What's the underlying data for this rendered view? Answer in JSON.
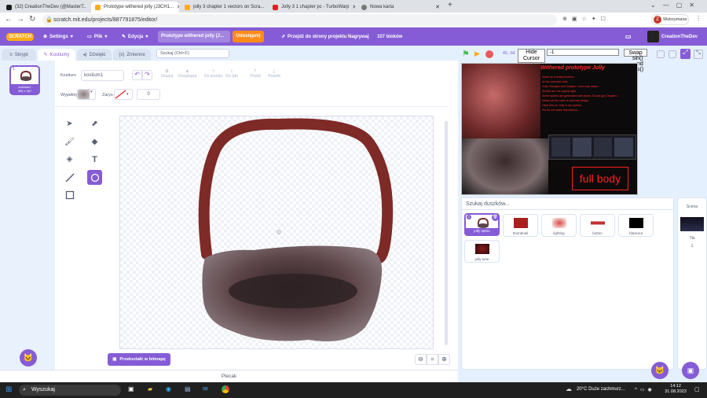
{
  "browser": {
    "tabs": [
      {
        "title": "(32) CreationTheDev (@MasterT..",
        "color": "#1d1d1d",
        "active": false
      },
      {
        "title": "Prototype withered jolly (J3CH1...",
        "color": "#ffab19",
        "active": true
      },
      {
        "title": "jolly 3 chapter 1 vectors on Scra...",
        "color": "#ffab19",
        "active": false
      },
      {
        "title": "Jolly 3 1 chapter pc - TurboWarp",
        "color": "#e02020",
        "active": false
      },
      {
        "title": "Nowa karta",
        "color": "#777",
        "active": false
      }
    ],
    "new_tab_label": "+",
    "url": "scratch.mit.edu/projects/887791875/editor/",
    "profile_label": "Wstrzymano",
    "profile_initial": "Z"
  },
  "menu": {
    "logo": "SCRATCH",
    "settings": "Settings",
    "file": "Plik",
    "edit": "Edycja",
    "project_title": "Prototype withered jolly (J...",
    "share": "Udostępnij",
    "go_to_project": "Przejdź do strony projektu",
    "record": "Nagrywaj",
    "blocks_count": "107 bloków",
    "username": "CreationTheDev"
  },
  "editor_tabs": {
    "code": "Skrypt",
    "costumes": "Kostiumy",
    "sounds": "Dźwięki",
    "variables": "Zmienne"
  },
  "search_placeholder": "Szukaj (Ctrl+F)",
  "costume": {
    "number": "1",
    "name": "kostium1",
    "size": "306 x 267"
  },
  "paint": {
    "costume_label": "Kostium",
    "costume_name": "kostium1",
    "group": "Grupuj",
    "ungroup": "Rozgrupuj",
    "forward": "Do przodu",
    "backward": "Do tyłu",
    "front": "Przód",
    "back": "Powrót",
    "fill_label": "Wypełnij",
    "outline_label": "Zarys",
    "outline_width": "0",
    "convert_bitmap": "Przekształć w bitmapę"
  },
  "stage": {
    "hide_cursor": "Hide Cursor",
    "value_field": "-1",
    "swap_label": "Swap",
    "swap_overflow": [
      "sin()",
      "nd",
      "s()"
    ],
    "title_text": "Withered prototype Jolly",
    "info_lines": [
      "Made by CreationTheDev",
      "Art by reversed Jolly",
      "Jolly Changes and Chapter 1 lore was drawn",
      "Sprites are not copied right",
      "Some sprites are generated with (from) J3 and got Chapter 1",
      "Added all the ones to add tmy design",
      "Have this on Jolly in my opinion",
      "Pls do not make this without ..."
    ],
    "full_body": "full body",
    "sprite_search": "Szukaj duszków...",
    "sprites": [
      {
        "name": "jolly optoo",
        "thumb": "#7a2a2a",
        "selected": true
      },
      {
        "name": "thumbnail",
        "thumb": "#aa1e1e",
        "selected": false
      },
      {
        "name": "lighting",
        "thumb": "#bb2b2b",
        "selected": false
      },
      {
        "name": "button",
        "thumb": "#c23030",
        "selected": false
      },
      {
        "name": "blackout",
        "thumb": "#000000",
        "selected": false
      },
      {
        "name": "jolly tone",
        "thumb": "#8a1a1a",
        "selected": false
      }
    ],
    "scene_label": "Scena",
    "backdrops_label": "Tła",
    "backdrops_count": "1"
  },
  "backpack": "Plecak",
  "taskbar": {
    "search": "Wyszukaj",
    "weather": "20°C  Duże zachmurz...",
    "time": "14:12",
    "date": "31.08.2023"
  }
}
